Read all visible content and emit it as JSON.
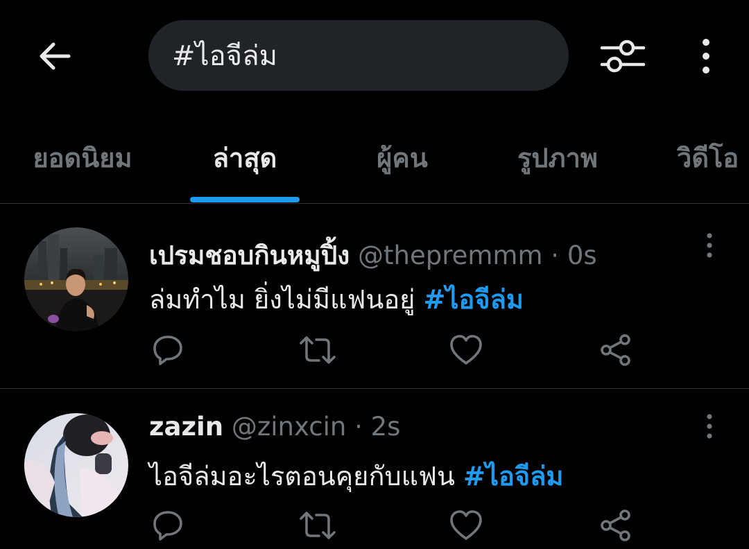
{
  "search": {
    "query": "#ไอจีล่ม"
  },
  "tabs": [
    {
      "label": "ยอดนิยม"
    },
    {
      "label": "ล่าสุด"
    },
    {
      "label": "ผู้คน"
    },
    {
      "label": "รูปภาพ"
    },
    {
      "label": "วิดีโอ"
    }
  ],
  "active_tab": "ล่าสุด",
  "tweets": [
    {
      "display_name": "เปรมชอบกินหมูปิ้ง",
      "handle": "@thepremmm",
      "separator": "·",
      "time": "0s",
      "text": "ล่มทำไม ยิ่งไม่มีแฟนอยู่ ",
      "hashtag": "#ไอจีล่ม"
    },
    {
      "display_name": "zazin",
      "handle": "@zinxcin",
      "separator": "·",
      "time": "2s",
      "text": "ไอจีล่มอะไรตอนคุยกับแฟน ",
      "hashtag": "#ไอจีล่ม"
    }
  ],
  "icons": {
    "back": "arrow-left-icon",
    "filter": "sliders-icon",
    "more": "more-vertical-icon",
    "reply": "reply-icon",
    "retweet": "retweet-icon",
    "like": "heart-icon",
    "share": "share-icon"
  },
  "colors": {
    "background": "#000000",
    "accent": "#1d9bf0",
    "text_primary": "#e7e9ea",
    "text_secondary": "#71767b",
    "search_bg": "#202327",
    "divider": "#2f3336"
  }
}
